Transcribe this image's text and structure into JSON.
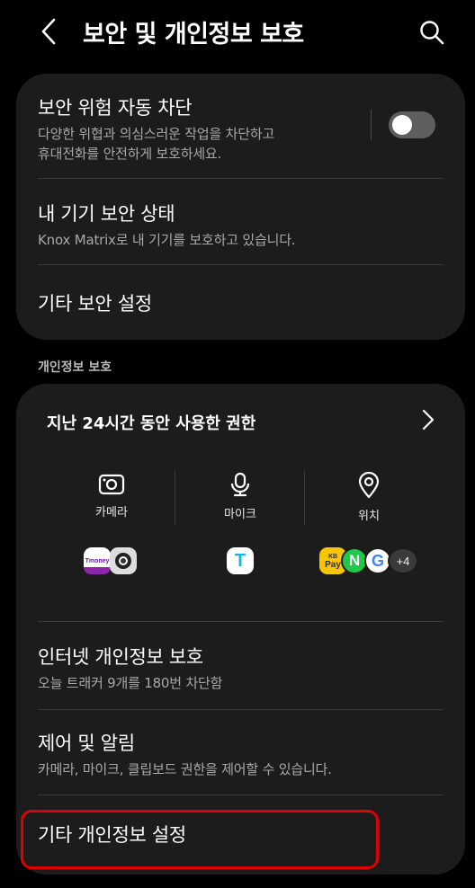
{
  "header": {
    "title": "보안 및 개인정보 보호",
    "back_icon": "chevron-left-icon",
    "search_icon": "search-icon"
  },
  "security": {
    "auto_block": {
      "title": "보안 위험 자동 차단",
      "subtitle_line1": "다양한 위협과 의심스러운 작업을 차단하고",
      "subtitle_line2": "휴대전화를 안전하게 보호하세요.",
      "enabled": false
    },
    "device_status": {
      "title": "내 기기 보안 상태",
      "subtitle": "Knox Matrix로 내 기기를 보호하고 있습니다."
    },
    "other_security": {
      "title": "기타 보안 설정"
    }
  },
  "privacy": {
    "section_label": "개인정보 보호",
    "permissions": {
      "title": "지난 24시간 동안 사용한 권한",
      "columns": [
        {
          "label": "카메라",
          "icon": "camera-icon",
          "apps": [
            "Tmoney",
            "camera-app"
          ]
        },
        {
          "label": "마이크",
          "icon": "microphone-icon",
          "apps": [
            "T"
          ]
        },
        {
          "label": "위치",
          "icon": "location-pin-icon",
          "apps": [
            "KB Pay",
            "N",
            "G"
          ],
          "more": "+4"
        }
      ],
      "app_texts": {
        "tmoney": "Tmoney",
        "t": "T",
        "kbpay_top": "KB",
        "kbpay_bottom": "Pay",
        "n": "N",
        "g": "G"
      }
    },
    "internet": {
      "title": "인터넷 개인정보 보호",
      "subtitle": "오늘 트래커 9개를 180번 차단함"
    },
    "controls": {
      "title": "제어 및 알림",
      "subtitle": "카메라, 마이크, 클립보드 권한을 제어할 수 있습니다."
    },
    "other_privacy": {
      "title": "기타 개인정보 설정"
    }
  },
  "colors": {
    "background": "#000000",
    "card": "#1c1c1c",
    "subtext": "#a9a9a9",
    "highlight": "#e00000"
  }
}
